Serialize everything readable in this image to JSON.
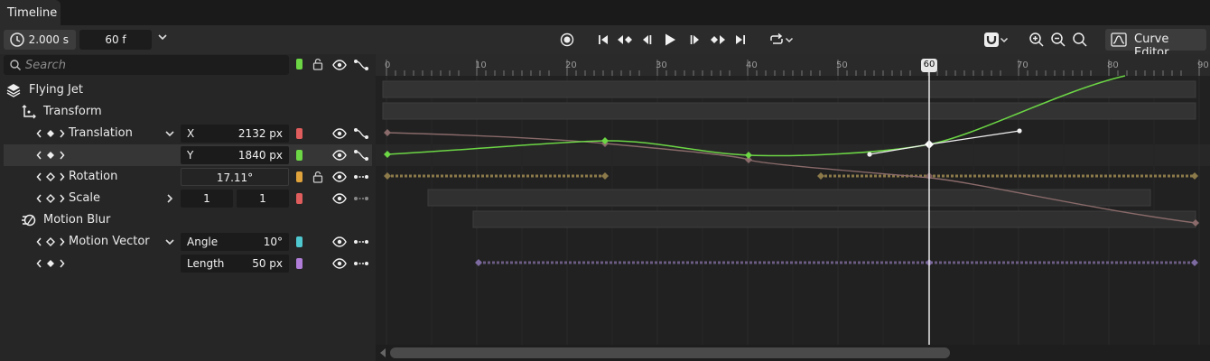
{
  "tab": {
    "title": "Timeline"
  },
  "toolbar": {
    "time": "2.000 s",
    "frames": "60 f",
    "curve_editor_label": "Curve Editor"
  },
  "search": {
    "placeholder": "Search"
  },
  "tree": {
    "object": "Flying Jet",
    "transform": "Transform",
    "translation": {
      "label": "Translation",
      "x_label": "X",
      "x_value": "2132 px",
      "y_label": "Y",
      "y_value": "1840 px"
    },
    "rotation": {
      "label": "Rotation",
      "value": "17.11°"
    },
    "scale": {
      "label": "Scale",
      "x_value": "1",
      "y_value": "1"
    },
    "motion_blur": "Motion Blur",
    "motion_vector": {
      "label": "Motion Vector",
      "angle_label": "Angle",
      "angle_value": "10°",
      "length_label": "Length",
      "length_value": "50 px"
    }
  },
  "colors": {
    "green": "#6cd645",
    "red": "#e05d5d",
    "orange": "#e0a33c",
    "cyan": "#4fc8d0",
    "purple": "#b07ed8"
  },
  "ruler": {
    "labels": [
      "0",
      "10",
      "20",
      "30",
      "40",
      "50",
      "60",
      "70",
      "80",
      "90"
    ],
    "current_frame": "60"
  }
}
